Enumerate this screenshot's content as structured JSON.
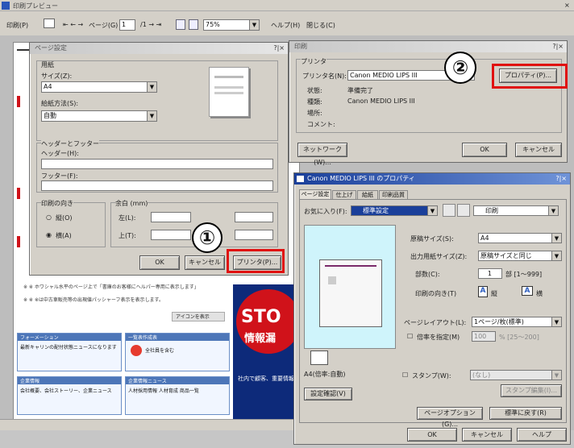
{
  "colors": {
    "accent_red": "#e01010",
    "title_blue": "#1a3f9a",
    "preview_cyan": "#cff4fb",
    "poster_red": "#d0121a",
    "chrome": "#d4d0c8"
  },
  "app": {
    "title": "印刷プレビュー",
    "toolbar": {
      "print": "印刷(P)",
      "page_label": "ページ(G)",
      "page_value": "1",
      "zoom": "75%",
      "help": "ヘルプ(H)",
      "close": "閉じる(C)"
    }
  },
  "page_setup": {
    "title": "ページ設定",
    "close": "?|×",
    "paper_group": "用紙",
    "size_label": "サイズ(Z):",
    "size_value": "A4",
    "source_label": "給紙方法(S):",
    "source_value": "自動",
    "headers_group": "ヘッダーとフッター",
    "header_label": "ヘッダー(H):",
    "footer_label": "フッター(F):",
    "orientation_group": "印刷の向き",
    "portrait": "縦(O)",
    "landscape": "横(A)",
    "margins_group": "余白 (mm)",
    "left": "左(L):",
    "top": "上(T):",
    "ok": "OK",
    "cancel": "キャンセル",
    "printer": "プリンタ(P)..."
  },
  "print_dialog": {
    "title": "印刷",
    "close": "?|×",
    "group": "プリンタ",
    "name_label": "プリンタ名(N):",
    "name_value": "Canon MEDIO LIPS III",
    "properties": "プロパティ(P)...",
    "status_label": "状態:",
    "status_value": "準備完了",
    "type_label": "種類:",
    "type_value": "Canon MEDIO LIPS III",
    "where_label": "場所:",
    "comment_label": "コメント:",
    "network": "ネットワーク(W)...",
    "ok": "OK",
    "cancel": "キャンセル"
  },
  "props": {
    "title": "Canon MEDIO LIPS III のプロパティ",
    "close": "?|×",
    "tabs": [
      "ページ設定",
      "仕上げ",
      "給紙",
      "印刷品質"
    ],
    "favorites_label": "お気に入り(F):",
    "favorites_value": "標準設定",
    "output_value": "印刷",
    "paper_size_label": "原稿サイズ(S):",
    "paper_size_value": "A4",
    "output_size_label": "出力用紙サイズ(Z):",
    "output_size_value": "原稿サイズと同じ",
    "copies_label": "部数(C):",
    "copies_value": "1",
    "copies_range": "部 [1～999]",
    "orientation_label": "印刷の向き(T)",
    "portrait": "縦",
    "landscape": "横",
    "layout_label": "ページレイアウト(L):",
    "layout_value": "1ページ/枚(標準)",
    "scale_label": "倍率を指定(M)",
    "scale_value": "100",
    "scale_range": "% [25～200]",
    "paper_caption": "A4(倍率:自動)",
    "stamp_label": "スタンプ(W):",
    "stamp_value": "(なし)",
    "stamp_edit": "スタンプ編集(I)...",
    "view_settings": "設定確認(V)",
    "page_options": "ページオプション(G)...",
    "restore": "標準に戻す(R)",
    "ok": "OK",
    "cancel": "キャンセル",
    "help": "ヘルプ"
  },
  "background_page": {
    "line1": "※  ※  ホワシャル水平のページ上で「書庫のお客様にヘルパー専用に表示します」",
    "line2": "※  ※  ※は中古車販売等の出現値パッシャーフ表示を表示します。",
    "box1_title": "フォーメーション",
    "box1_text": "最新キャリンの配付状態ニュースになります",
    "box2_title": "一覧表作成表",
    "box2_text": "全社員を含む",
    "box3_title": "企業情報",
    "box3_text": "会社概要、会社ストーリー、企業ニュース",
    "box4_title": "企業情報ニュース",
    "box4_text": "人材採用情報 人材育成 商品一覧",
    "poster_big": "STO",
    "poster_sub": "情報漏",
    "poster_note": "社内で顧客、重要情報",
    "scrollbar_word": "アイコンを表示"
  },
  "callouts": {
    "one": "①",
    "two": "②"
  }
}
